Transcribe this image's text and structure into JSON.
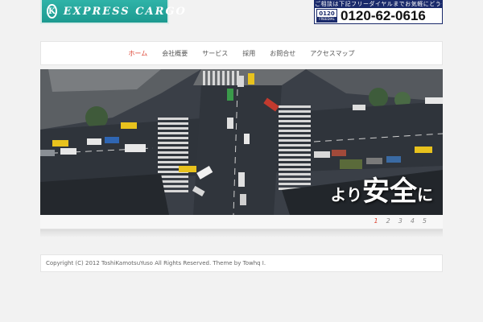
{
  "header": {
    "logo": {
      "emblem": "K",
      "text": "EXPRESS CARGO"
    },
    "phone": {
      "notice": "ご相談は下記フリーダイヤルまでお気軽にどうぞ!",
      "freedial_number": "0120",
      "freedial_label": "FREEDIAL",
      "number": "0120-62-0616"
    }
  },
  "nav": {
    "items": [
      {
        "label": "ホーム",
        "active": true
      },
      {
        "label": "会社概要"
      },
      {
        "label": "サービス"
      },
      {
        "label": "採用"
      },
      {
        "label": "お問合せ"
      },
      {
        "label": "アクセスマップ"
      }
    ]
  },
  "slider": {
    "caption_small_1": "より",
    "caption_big": "安全",
    "caption_small_2": "に",
    "pages": [
      "1",
      "2",
      "3",
      "4",
      "5"
    ],
    "active_page": 0
  },
  "footer": {
    "copyright": "Copyright (C) 2012 ToshiKamotsuYuso All Rights Reserved. Theme by Towhq I."
  },
  "colors": {
    "logo_bg": "#1d9a90",
    "phone_navy": "#1a2a6b",
    "accent": "#dd4433"
  }
}
